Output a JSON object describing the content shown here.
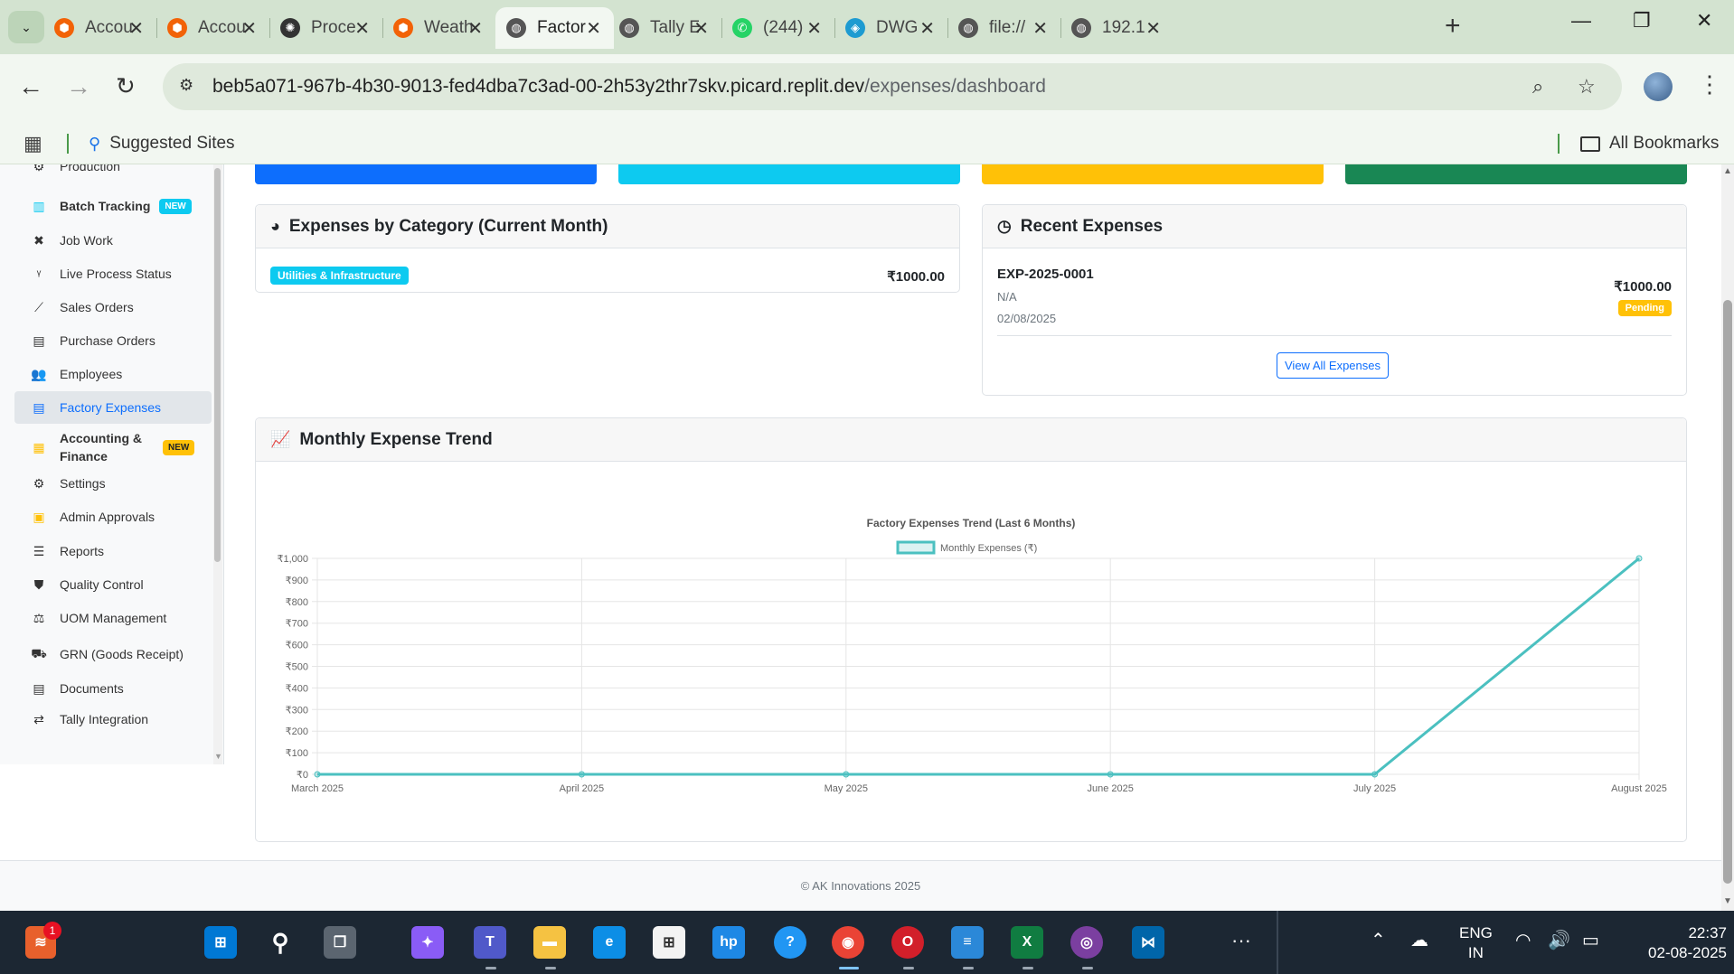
{
  "browser": {
    "tabs": [
      {
        "title": "Accou",
        "icon": "replit-icon",
        "color": "#f26207"
      },
      {
        "title": "Accou",
        "icon": "replit-icon",
        "color": "#f26207"
      },
      {
        "title": "Proce",
        "icon": "chatgpt-icon",
        "color": "#333333"
      },
      {
        "title": "Weath",
        "icon": "replit-icon",
        "color": "#f26207"
      },
      {
        "title": "Factor",
        "icon": "globe-icon",
        "color": "#555555",
        "active": true
      },
      {
        "title": "Tally E",
        "icon": "globe-icon",
        "color": "#555555"
      },
      {
        "title": "(244)",
        "icon": "whatsapp-icon",
        "color": "#25d366"
      },
      {
        "title": "DWG",
        "icon": "dwg-icon",
        "color": "#1d9bd1"
      },
      {
        "title": "file://",
        "icon": "globe-icon",
        "color": "#555555"
      },
      {
        "title": "192.1",
        "icon": "globe-icon",
        "color": "#555555"
      }
    ],
    "url_host": "beb5a071-967b-4b30-9013-fed4dba7c3ad-00-2h53y2thr7skv.picard.replit.dev",
    "url_path": "/expenses/dashboard",
    "bookmarks": {
      "suggested": "Suggested Sites",
      "all": "All Bookmarks"
    }
  },
  "sidebar": {
    "items": [
      {
        "label": "Production",
        "icon": "gear-icon"
      },
      {
        "label": "Batch Tracking",
        "icon": "barcode-icon",
        "badge": "NEW",
        "bold": true
      },
      {
        "label": "Job Work",
        "icon": "tools-icon"
      },
      {
        "label": "Live Process Status",
        "icon": "signal-icon"
      },
      {
        "label": "Sales Orders",
        "icon": "chart-line-icon"
      },
      {
        "label": "Purchase Orders",
        "icon": "file-icon"
      },
      {
        "label": "Employees",
        "icon": "users-icon"
      },
      {
        "label": "Factory Expenses",
        "icon": "receipt-icon",
        "active": true
      },
      {
        "label": "Accounting & Finance",
        "icon": "calculator-icon",
        "badge": "NEW",
        "bold": true
      },
      {
        "label": "Settings",
        "icon": "gear-icon"
      },
      {
        "label": "Admin Approvals",
        "icon": "shield-check-icon"
      },
      {
        "label": "Reports",
        "icon": "list-icon"
      },
      {
        "label": "Quality Control",
        "icon": "shield-icon"
      },
      {
        "label": "UOM Management",
        "icon": "scale-icon"
      },
      {
        "label": "GRN (Goods Receipt)",
        "icon": "truck-icon"
      },
      {
        "label": "Documents",
        "icon": "document-icon"
      },
      {
        "label": "Tally Integration",
        "icon": "exchange-icon"
      }
    ]
  },
  "category_card": {
    "title": "Expenses by Category (Current Month)",
    "rows": [
      {
        "category": "Utilities & Infrastructure",
        "amount": "₹1000.00"
      }
    ]
  },
  "recent_card": {
    "title": "Recent Expenses",
    "items": [
      {
        "id": "EXP-2025-0001",
        "vendor": "N/A",
        "date": "02/08/2025",
        "amount": "₹1000.00",
        "status": "Pending"
      }
    ],
    "view_all": "View All Expenses"
  },
  "trend_card": {
    "title": "Monthly Expense Trend"
  },
  "chart_data": {
    "type": "line",
    "title": "Factory Expenses Trend (Last 6 Months)",
    "categories": [
      "March 2025",
      "April 2025",
      "May 2025",
      "June 2025",
      "July 2025",
      "August 2025"
    ],
    "series": [
      {
        "name": "Monthly Expenses (₹)",
        "values": [
          0,
          0,
          0,
          0,
          0,
          1000
        ],
        "color": "#4bc0c0"
      }
    ],
    "ylim": [
      0,
      1000
    ],
    "yticks": [
      "₹0",
      "₹100",
      "₹200",
      "₹300",
      "₹400",
      "₹500",
      "₹600",
      "₹700",
      "₹800",
      "₹900",
      "₹1,000"
    ],
    "legend": "top",
    "grid": true
  },
  "footer": {
    "text": "© AK Innovations 2025"
  },
  "taskbar": {
    "lang_top": "ENG",
    "lang_bottom": "IN",
    "time": "22:37",
    "date": "02-08-2025",
    "notification_count": "1"
  },
  "colors": {
    "primary": "#0d6efd",
    "info": "#0dcaf0",
    "warning": "#ffc107",
    "success": "#198754"
  }
}
